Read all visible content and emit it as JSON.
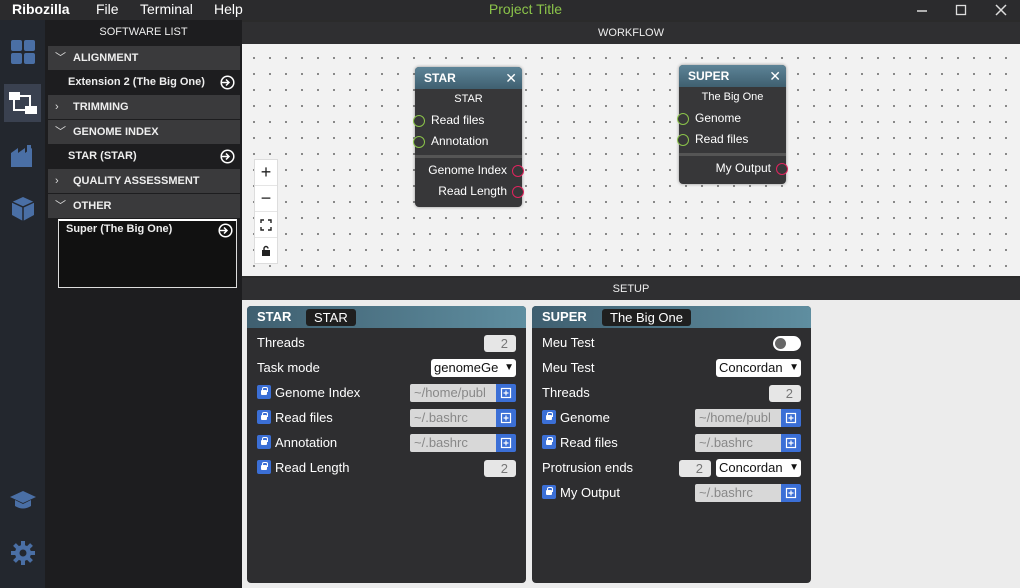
{
  "app": {
    "brand": "Ribozilla",
    "project_title": "Project Title",
    "menu": [
      "File",
      "Terminal",
      "Help"
    ]
  },
  "iconbar": [
    "dashboard-icon",
    "workflow-icon",
    "factory-icon",
    "package-icon",
    "learn-icon",
    "settings-icon"
  ],
  "sidebar": {
    "title": "SOFTWARE LIST",
    "categories": [
      {
        "label": "ALIGNMENT",
        "expanded": true,
        "items": [
          "Extension 2 (The Big One)"
        ]
      },
      {
        "label": "TRIMMING",
        "expanded": false,
        "items": []
      },
      {
        "label": "GENOME INDEX",
        "expanded": true,
        "items": [
          "STAR (STAR)"
        ]
      },
      {
        "label": "QUALITY ASSESSMENT",
        "expanded": false,
        "items": []
      },
      {
        "label": "OTHER",
        "expanded": true,
        "items": [
          "Super (The Big One)"
        ]
      }
    ]
  },
  "workflow": {
    "title": "WORKFLOW",
    "nodes": [
      {
        "name": "STAR",
        "subtitle": "STAR",
        "inputs": [
          "Read files",
          "Annotation"
        ],
        "outputs": [
          "Genome Index",
          "Read Length"
        ]
      },
      {
        "name": "SUPER",
        "subtitle": "The Big One",
        "inputs": [
          "Genome",
          "Read files"
        ],
        "outputs": [
          "My Output"
        ]
      }
    ],
    "controls": [
      "zoom-in",
      "zoom-out",
      "fit-view",
      "lock"
    ]
  },
  "setup": {
    "title": "SETUP",
    "panels": [
      {
        "name": "STAR",
        "tag": "STAR",
        "fields": [
          {
            "label": "Threads",
            "type": "number",
            "value": "2"
          },
          {
            "label": "Task mode",
            "type": "select",
            "value": "genomeGe"
          },
          {
            "label": "Genome Index",
            "type": "file",
            "value": "~/home/publ",
            "locked": true
          },
          {
            "label": "Read files",
            "type": "file",
            "value": "~/.bashrc",
            "locked": true
          },
          {
            "label": "Annotation",
            "type": "file",
            "value": "~/.bashrc",
            "locked": true
          },
          {
            "label": "Read Length",
            "type": "number",
            "value": "2",
            "locked": true
          }
        ]
      },
      {
        "name": "SUPER",
        "tag": "The Big One",
        "fields": [
          {
            "label": "Meu Test",
            "type": "toggle",
            "value": false
          },
          {
            "label": "Meu Test",
            "type": "select",
            "value": "Concordan"
          },
          {
            "label": "Threads",
            "type": "number",
            "value": "2"
          },
          {
            "label": "Genome",
            "type": "file",
            "value": "~/home/publ",
            "locked": true
          },
          {
            "label": "Read files",
            "type": "file",
            "value": "~/.bashrc",
            "locked": true
          },
          {
            "label": "Protrusion ends",
            "type": "number+select",
            "value": "2",
            "select": "Concordan"
          },
          {
            "label": "My Output",
            "type": "file",
            "value": "~/.bashrc",
            "locked": true
          }
        ]
      }
    ]
  },
  "colors": {
    "accent_green": "#8bc34a",
    "input_port": "#8bc34a",
    "output_port": "#e0245e",
    "lock_blue": "#3b6fd6"
  }
}
